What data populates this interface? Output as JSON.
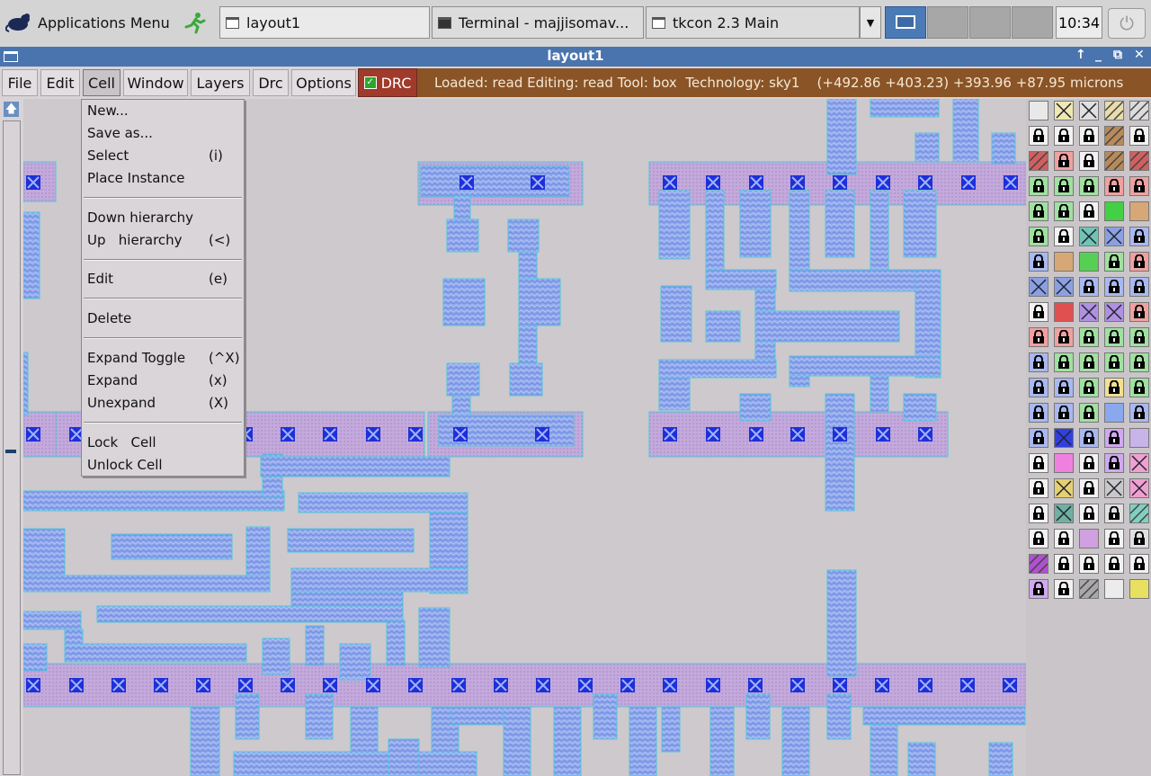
{
  "panel": {
    "apps_label": "Applications Menu",
    "tasks": [
      {
        "label": "layout1"
      },
      {
        "label": "Terminal - majjisomav..."
      },
      {
        "label": "tkcon 2.3 Main"
      }
    ],
    "clock": "10:34"
  },
  "window": {
    "title": "layout1"
  },
  "menubar": {
    "items": [
      "File",
      "Edit",
      "Cell",
      "Window",
      "Layers",
      "Drc",
      "Options"
    ],
    "drc_label": "DRC",
    "status": "Loaded: read Editing: read Tool: box  Technology: sky1    (+492.86 +403.23) +393.96 +87.95 microns"
  },
  "cell_menu": {
    "groups": [
      [
        {
          "label": "New...",
          "accel": ""
        },
        {
          "label": "Save as...",
          "accel": ""
        },
        {
          "label": "Select",
          "accel": "(i)"
        },
        {
          "label": "Place Instance",
          "accel": ""
        }
      ],
      [
        {
          "label": "Down hierarchy",
          "accel": ""
        },
        {
          "label": "Up   hierarchy",
          "accel": "(<)"
        }
      ],
      [
        {
          "label": "Edit",
          "accel": "(e)"
        }
      ],
      [
        {
          "label": "Delete",
          "accel": ""
        }
      ],
      [
        {
          "label": "Expand Toggle",
          "accel": "(^X)"
        },
        {
          "label": "Expand",
          "accel": "(x)"
        },
        {
          "label": "Unexpand",
          "accel": "(X)"
        }
      ],
      [
        {
          "label": "Lock   Cell",
          "accel": ""
        },
        {
          "label": "Unlock Cell",
          "accel": ""
        }
      ]
    ]
  },
  "colors": {
    "metal": "#8da6ec",
    "metal_edge": "#4fc7dc",
    "poly_rail": "#c9a7dc",
    "contact": "#1f2fd8",
    "drc_button": "#a03a2a",
    "status_bar": "#8a5426",
    "title_bar": "#4a74ad"
  },
  "palette": {
    "rows": [
      [
        "dots",
        "yellow-box",
        "black-box",
        "tan-hatch",
        "diag-hatch"
      ],
      [
        "lock",
        "lock",
        "lock",
        "brown-hatch",
        "lock"
      ],
      [
        "red-hatch",
        "lock-red",
        "lock",
        "brown-hatch",
        "red-hatch"
      ],
      [
        "lock-green",
        "lock-green",
        "lock-green",
        "lock-red",
        "lock-red"
      ],
      [
        "lock-green",
        "lock-green",
        "lock",
        "green",
        "tan"
      ],
      [
        "lock-green",
        "lock",
        "x-teal",
        "x-blue",
        "lock-blue"
      ],
      [
        "lock-blue",
        "tan-dots",
        "green-dots",
        "lock-green",
        "lock-red"
      ],
      [
        "x-blue",
        "x-blue",
        "lock-blue",
        "lock-blue",
        "lock-blue"
      ],
      [
        "lock",
        "red",
        "x-purple",
        "x-purple",
        "lock-red"
      ],
      [
        "lock-red",
        "lock-red",
        "lock-green",
        "lock-green",
        "lock-green"
      ],
      [
        "lock-blue",
        "lock-green",
        "lock-green",
        "lock-green",
        "lock-green"
      ],
      [
        "lock-blue",
        "lock-blue",
        "lock-green",
        "lock-yellow",
        "lock-green"
      ],
      [
        "lock-blue",
        "lock-blue",
        "lock-green",
        "blue-lines",
        "lock-blue"
      ],
      [
        "lock-blue",
        "blue-x",
        "lock-blue",
        "lock-purple",
        "lavender"
      ],
      [
        "lock",
        "pink",
        "lock",
        "lock-purple",
        "pink-x"
      ],
      [
        "lock",
        "yellow-x",
        "lock",
        "gray-x",
        "pink-x"
      ],
      [
        "lock",
        "teal-x",
        "lock",
        "lock-black",
        "teal-diag"
      ],
      [
        "lock",
        "lock",
        "purple-dots",
        "lock",
        "lock-black"
      ],
      [
        "purple-diag",
        "lock",
        "lock",
        "lock",
        "lock"
      ],
      [
        "lock-purple",
        "lock",
        "gray-diag",
        "white-dots",
        "yellow"
      ]
    ]
  }
}
